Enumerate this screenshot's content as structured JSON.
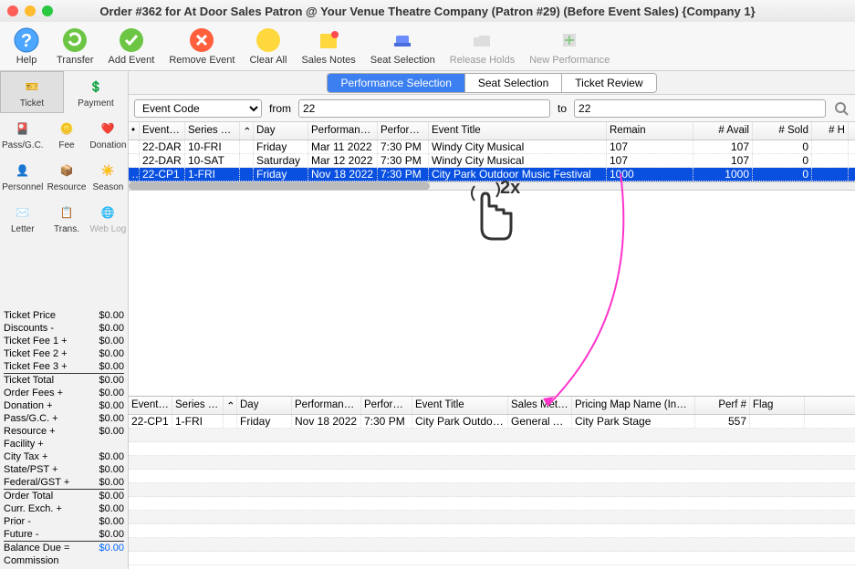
{
  "title": "Order #362 for At Door Sales Patron @ Your Venue Theatre Company (Patron #29) (Before Event Sales) {Company 1}",
  "toolbar": {
    "help": "Help",
    "transfer": "Transfer",
    "addevent": "Add Event",
    "removeevent": "Remove Event",
    "clearall": "Clear All",
    "salesnotes": "Sales Notes",
    "seatsel": "Seat Selection",
    "releaseholds": "Release Holds",
    "newperf": "New Performance"
  },
  "sidebar": {
    "ticket": "Ticket",
    "payment": "Payment",
    "passgc": "Pass/G.C.",
    "fee": "Fee",
    "donation": "Donation",
    "personnel": "Personnel",
    "resource": "Resource",
    "season": "Season",
    "letter": "Letter",
    "trans": "Trans.",
    "weblog": "Web Log"
  },
  "tabs": {
    "perf": "Performance Selection",
    "seat": "Seat Selection",
    "review": "Ticket Review"
  },
  "filter": {
    "field": "Event Code",
    "from": "from",
    "to": "to",
    "fromval": "22",
    "toval": "22"
  },
  "gridhead": {
    "bullet": "•",
    "event": "Event …",
    "series": "Series C…",
    "day": "Day",
    "perfdate": "Performanc…",
    "perftime": "Performa…",
    "title": "Event Title",
    "remain": "Remain",
    "avail": "# Avail",
    "sold": "# Sold",
    "h": "# H"
  },
  "rows": [
    {
      "event": "22-DAR",
      "series": "10-FRI",
      "day": "Friday",
      "date": "Mar 11 2022",
      "time": "7:30 PM",
      "title": "Windy City Musical",
      "remain": "107",
      "avail": "107",
      "sold": "0"
    },
    {
      "event": "22-DAR",
      "series": "10-SAT",
      "day": "Saturday",
      "date": "Mar 12 2022",
      "time": "7:30 PM",
      "title": "Windy City Musical",
      "remain": "107",
      "avail": "107",
      "sold": "0"
    },
    {
      "event": "22-CP1",
      "series": "1-FRI",
      "day": "Friday",
      "date": "Nov 18 2022",
      "time": "7:30 PM",
      "title": "City Park Outdoor Music Festival",
      "remain": "1000",
      "avail": "1000",
      "sold": "0"
    }
  ],
  "bottomhead": {
    "event": "Event …",
    "series": "Series C…",
    "day": "Day",
    "perfdate": "Performanc…",
    "perftime": "Performa…",
    "title": "Event Title",
    "meth": "Sales Meth…",
    "map": "Pricing Map Name (In…",
    "perfn": "Perf #",
    "flag": "Flag"
  },
  "bottomrows": [
    {
      "event": "22-CP1",
      "series": "1-FRI",
      "day": "Friday",
      "date": "Nov 18 2022",
      "time": "7:30 PM",
      "title": "City Park Outdo…",
      "meth": "General A…",
      "map": "City Park Stage",
      "perfn": "557",
      "flag": ""
    }
  ],
  "pricing": [
    {
      "label": "Ticket Price",
      "val": "$0.00"
    },
    {
      "label": "Discounts -",
      "val": "$0.00"
    },
    {
      "label": "Ticket Fee 1 +",
      "val": "$0.00"
    },
    {
      "label": "Ticket Fee 2 +",
      "val": "$0.00"
    },
    {
      "label": "Ticket Fee 3 +",
      "val": "$0.00"
    },
    {
      "label": "Ticket Total",
      "val": "$0.00",
      "bold": true
    },
    {
      "label": "Order Fees +",
      "val": "$0.00"
    },
    {
      "label": "Donation +",
      "val": "$0.00"
    },
    {
      "label": "Pass/G.C. +",
      "val": "$0.00"
    },
    {
      "label": "Resource +",
      "val": "$0.00"
    },
    {
      "label": "Facility +",
      "val": ""
    },
    {
      "label": "City Tax +",
      "val": "$0.00"
    },
    {
      "label": "State/PST +",
      "val": "$0.00"
    },
    {
      "label": "Federal/GST +",
      "val": "$0.00"
    },
    {
      "label": "Order Total",
      "val": "$0.00",
      "bold": true
    },
    {
      "label": "Curr. Exch. +",
      "val": "$0.00"
    },
    {
      "label": "Prior -",
      "val": "$0.00"
    },
    {
      "label": "Future -",
      "val": "$0.00"
    },
    {
      "label": "Balance Due =",
      "val": "$0.00",
      "bold": true,
      "blue": true
    },
    {
      "label": "Commission",
      "val": ""
    }
  ],
  "hint": "2x"
}
